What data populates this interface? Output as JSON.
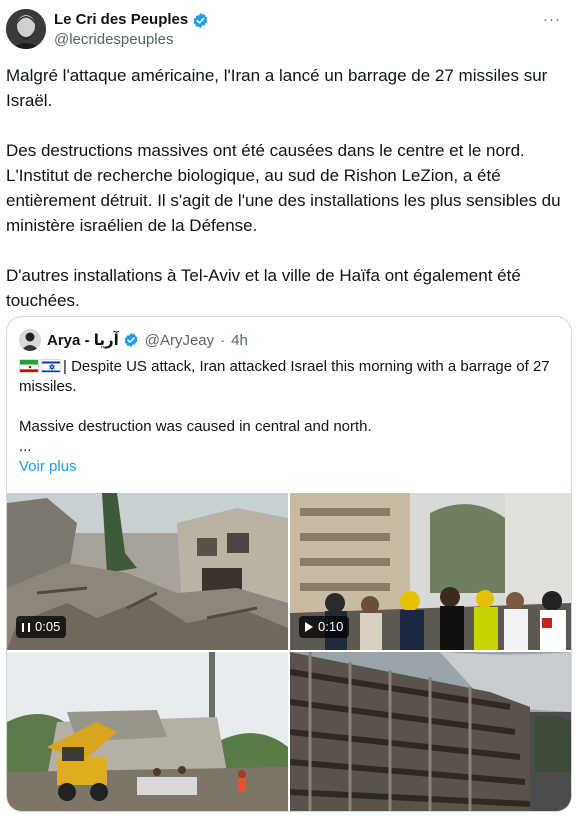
{
  "author": {
    "name": "Le Cri des Peuples",
    "handle": "@lecridespeuples",
    "avatar_icon": "portrait-avatar",
    "verified_icon": "verified-badge-icon"
  },
  "more_icon": "more-options-icon",
  "more_glyph": "···",
  "tweet": {
    "paragraphs": [
      "Malgré l'attaque américaine, l'Iran a lancé un barrage de 27 missiles sur Israël.",
      "Des destructions massives ont été causées dans le centre et le nord. L'Institut de recherche biologique, au sud de Rishon LeZion, a été entièrement détruit. Il s'agit de l'une des installations les plus sensibles du ministère israélien de la Défense.",
      "D'autres installations à Tel-Aviv et la ville de Haïfa ont également été touchées."
    ]
  },
  "quote": {
    "name": "Arya - آریا",
    "handle": "@AryJeay",
    "separator": "·",
    "time": "4h",
    "line1": "| Despite US attack, Iran attacked Israel this morning with a barrage of 27 missiles.",
    "line2": "Massive destruction was caused in central and north.",
    "ellipsis": "...",
    "see_more": "Voir plus",
    "flags": [
      "iran-flag-icon",
      "israel-flag-icon"
    ]
  },
  "media": [
    {
      "kind": "video",
      "duration": "0:05",
      "control_icon": "pause-icon"
    },
    {
      "kind": "video",
      "duration": "0:10",
      "control_icon": "play-icon"
    },
    {
      "kind": "image"
    },
    {
      "kind": "image"
    }
  ],
  "colors": {
    "link": "#1d9bf0",
    "secondary_text": "#536471",
    "border": "#cfd9de"
  }
}
